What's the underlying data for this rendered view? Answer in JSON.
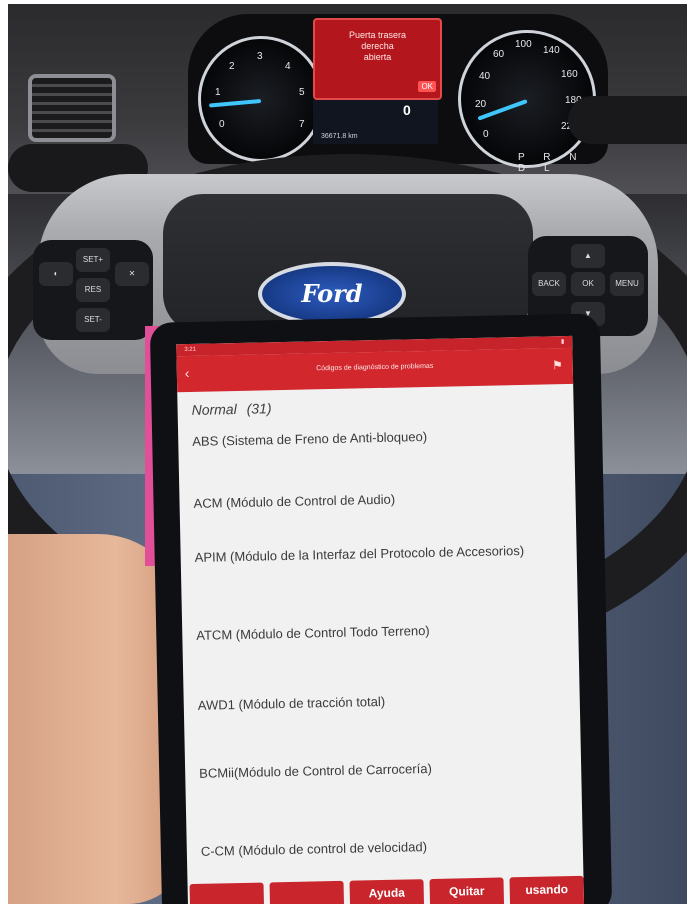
{
  "dashboard": {
    "alert_lines": [
      "Puerta trasera",
      "derecha",
      "abierta"
    ],
    "alert_ok": "OK",
    "speed": "0",
    "odometer": "36671.8 km",
    "gear_row": "P R N D L"
  },
  "wheel": {
    "logo": "Ford",
    "left_pad": [
      "SET+",
      "RES",
      "SET-"
    ],
    "right_pad": [
      "OK",
      "BACK",
      "MENU"
    ]
  },
  "tablet": {
    "status_time": "3:21",
    "title": "Códigos de diagnóstico de problemas",
    "section": {
      "label": "Normal",
      "count": "(31)"
    },
    "items": [
      "ABS (Sistema de Freno de Anti-bloqueo)",
      "ACM (Módulo de Control de Audio)",
      "APIM (Módulo de la Interfaz del Protocolo de Accesorios)",
      "ATCM (Módulo de Control Todo Terreno)",
      "AWD1 (Módulo de tracción total)",
      "BCMii(Módulo de Control de Carrocería)",
      "C-CM (Módulo de control de velocidad)"
    ],
    "bottom_buttons": [
      "",
      "",
      "Ayuda",
      "Quitar",
      "usando"
    ]
  },
  "colors": {
    "app_red": "#d1272d",
    "screen_bg": "#f1f1f1",
    "text": "#3a3a3a"
  }
}
